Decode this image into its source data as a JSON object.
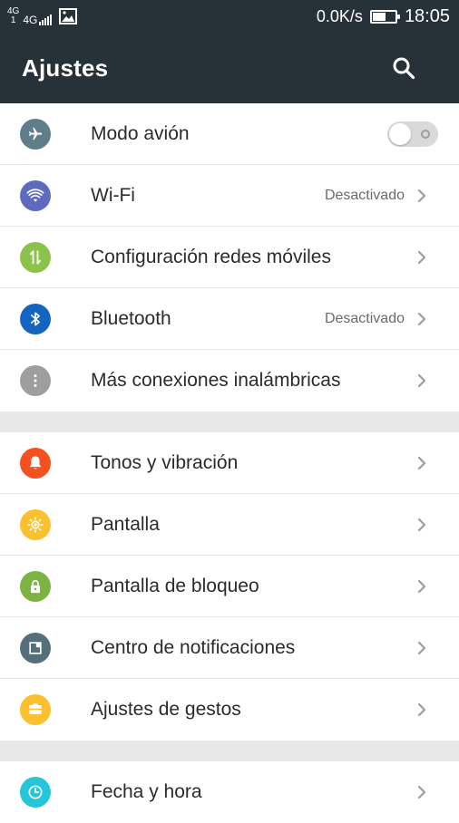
{
  "status_bar": {
    "sim_label_top": "4G",
    "sim_label_bottom": "1",
    "network_label": "4G",
    "speed": "0.0K/s",
    "time": "18:05",
    "battery_level": 0.55
  },
  "header": {
    "title": "Ajustes"
  },
  "colors": {
    "bar_bg": "#263238",
    "airplane": "#607d8b",
    "wifi": "#5c6bc0",
    "mobile": "#8bc34a",
    "bluetooth": "#1565c0",
    "more": "#9e9e9e",
    "tones": "#f4511e",
    "display": "#fbc02d",
    "lock": "#7cb342",
    "notifications": "#546e7a",
    "gestures": "#fbc02d",
    "datetime": "#26c6da"
  },
  "groups": [
    {
      "items": [
        {
          "label": "Modo avión",
          "icon": "airplane-icon",
          "control": "toggle",
          "on": false
        },
        {
          "label": "Wi-Fi",
          "icon": "wifi-icon",
          "value": "Desactivado"
        },
        {
          "label": "Configuración redes móviles",
          "icon": "mobile-data-icon"
        },
        {
          "label": "Bluetooth",
          "icon": "bluetooth-icon",
          "value": "Desactivado"
        },
        {
          "label": "Más conexiones inalámbricas",
          "icon": "more-vertical-icon"
        }
      ]
    },
    {
      "items": [
        {
          "label": "Tonos y vibración",
          "icon": "bell-icon"
        },
        {
          "label": "Pantalla",
          "icon": "brightness-icon"
        },
        {
          "label": "Pantalla de bloqueo",
          "icon": "lock-icon"
        },
        {
          "label": "Centro de notificaciones",
          "icon": "notification-icon"
        },
        {
          "label": "Ajustes de gestos",
          "icon": "gesture-icon"
        }
      ]
    },
    {
      "items": [
        {
          "label": "Fecha y hora",
          "icon": "clock-icon"
        }
      ]
    }
  ]
}
